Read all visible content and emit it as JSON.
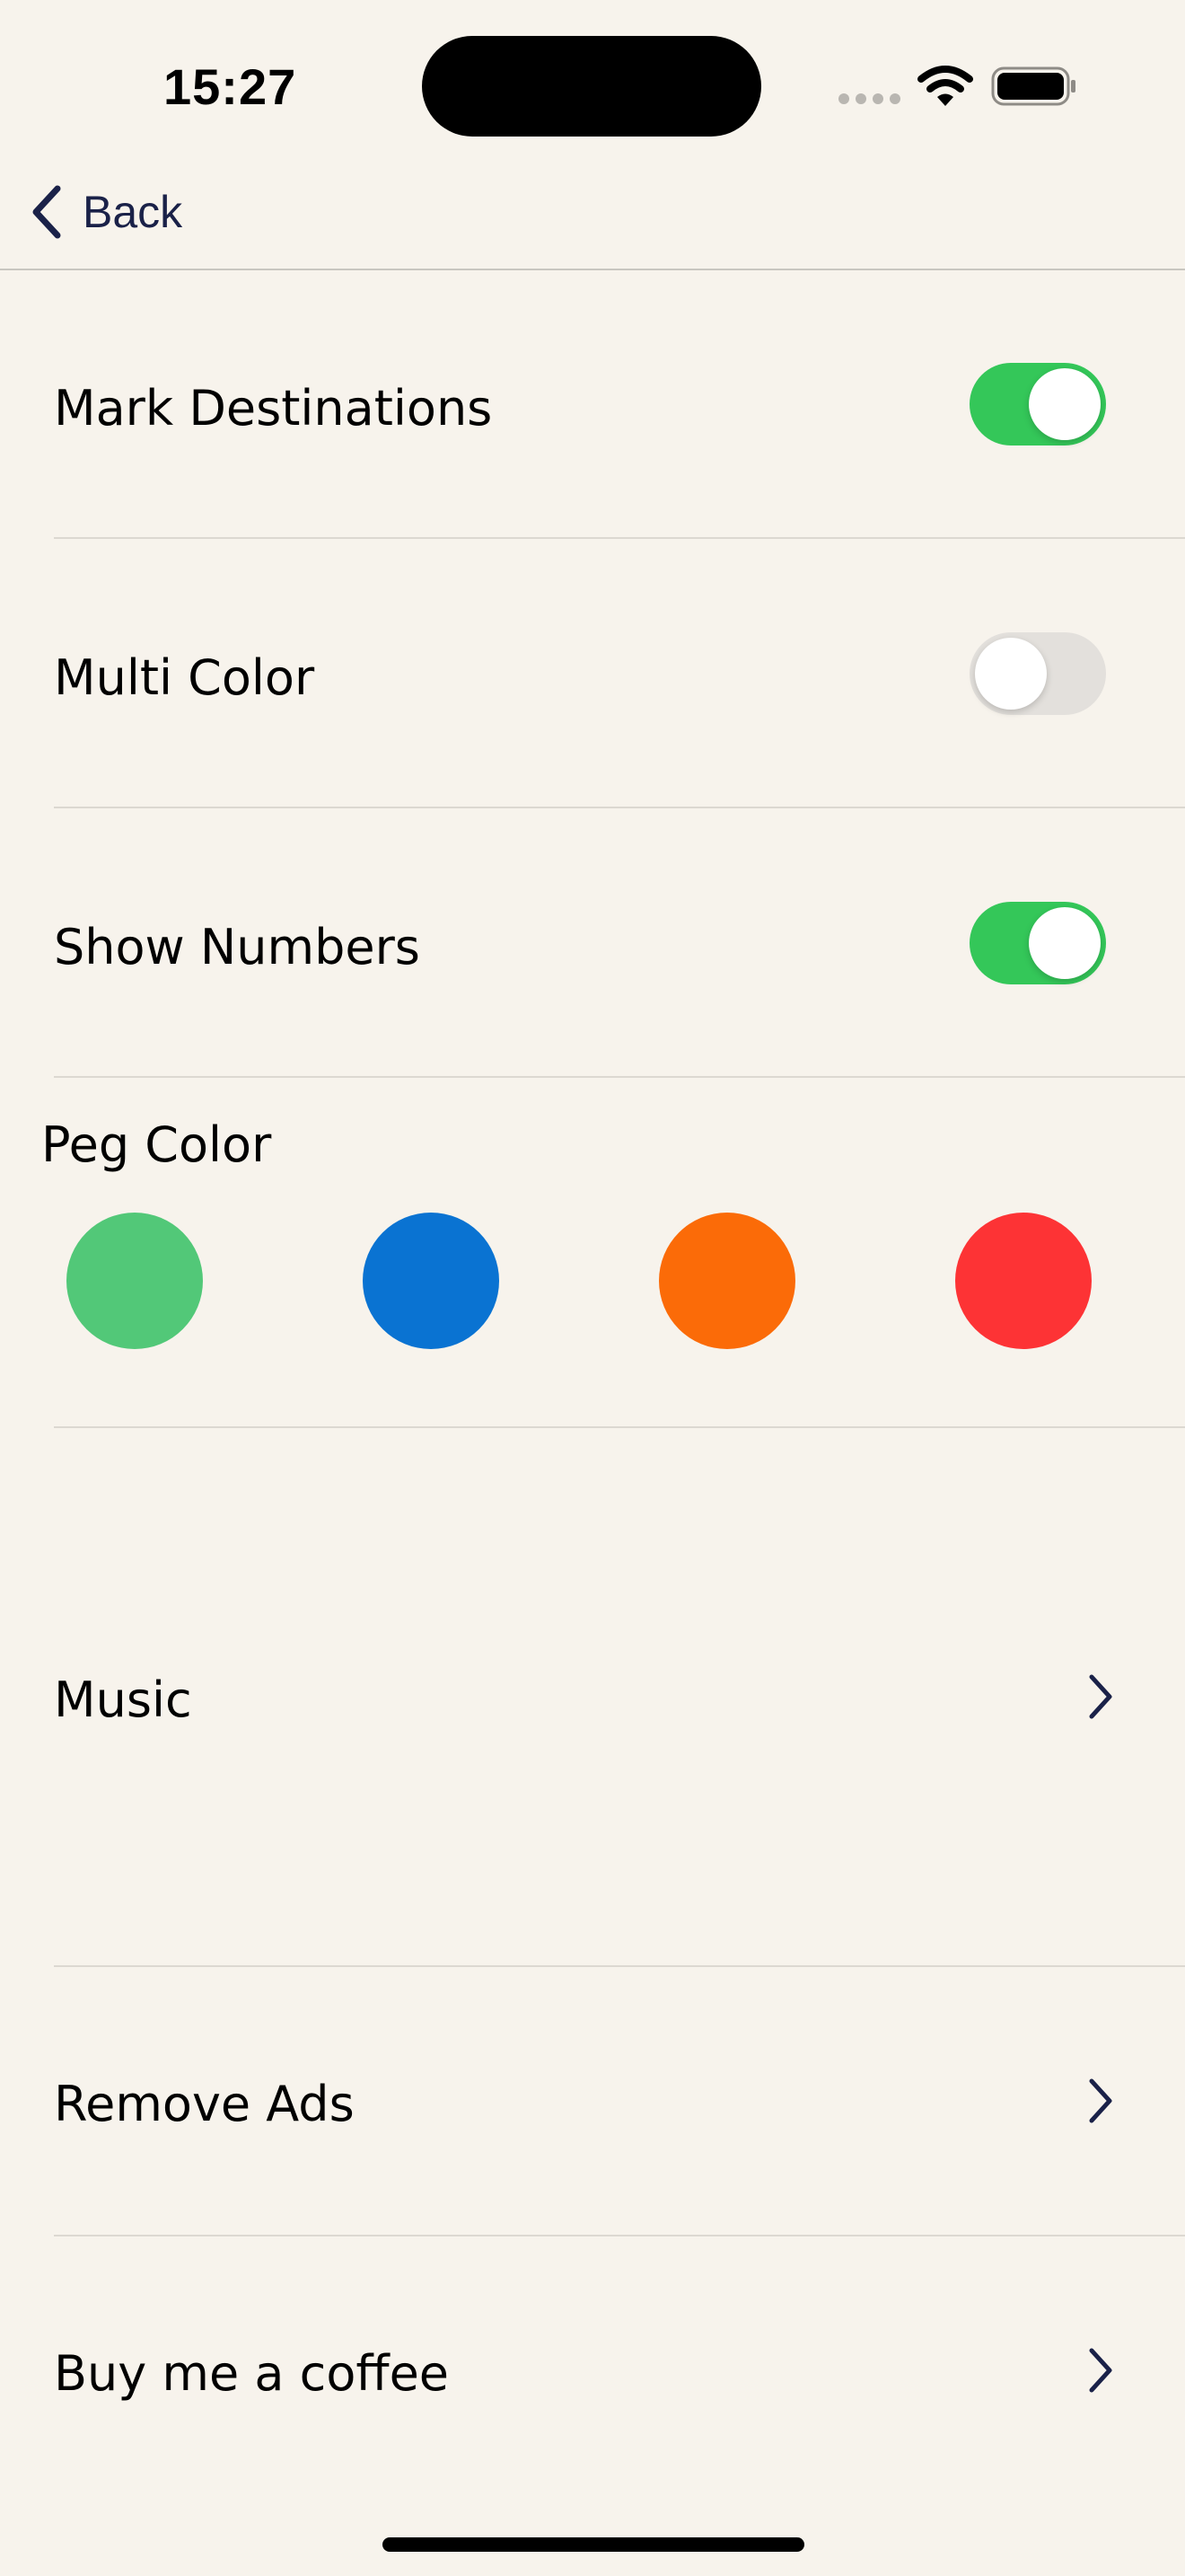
{
  "status_bar": {
    "time": "15:27",
    "icons": [
      "signal-icon",
      "wifi-icon",
      "battery-icon"
    ]
  },
  "nav": {
    "back_label": "Back",
    "back_icon": "chevron-left-icon",
    "accent_color": "#1a2148"
  },
  "settings": {
    "mark_destinations": {
      "label": "Mark Destinations",
      "enabled": true
    },
    "multi_color": {
      "label": "Multi Color",
      "enabled": false
    },
    "show_numbers": {
      "label": "Show Numbers",
      "enabled": true
    },
    "peg_color": {
      "label": "Peg Color",
      "options": [
        "#52c878",
        "#0a73d2",
        "#fb6b08",
        "#fd3335"
      ]
    },
    "music": {
      "label": "Music",
      "icon": "chevron-right-icon"
    },
    "remove_ads": {
      "label": "Remove Ads",
      "icon": "chevron-right-icon"
    },
    "buy_coffee": {
      "label": "Buy me a coffee",
      "icon": "chevron-right-icon"
    }
  },
  "colors": {
    "background": "#f7f3ec",
    "toggle_on": "#34c759",
    "toggle_off": "#e3e0dc"
  }
}
